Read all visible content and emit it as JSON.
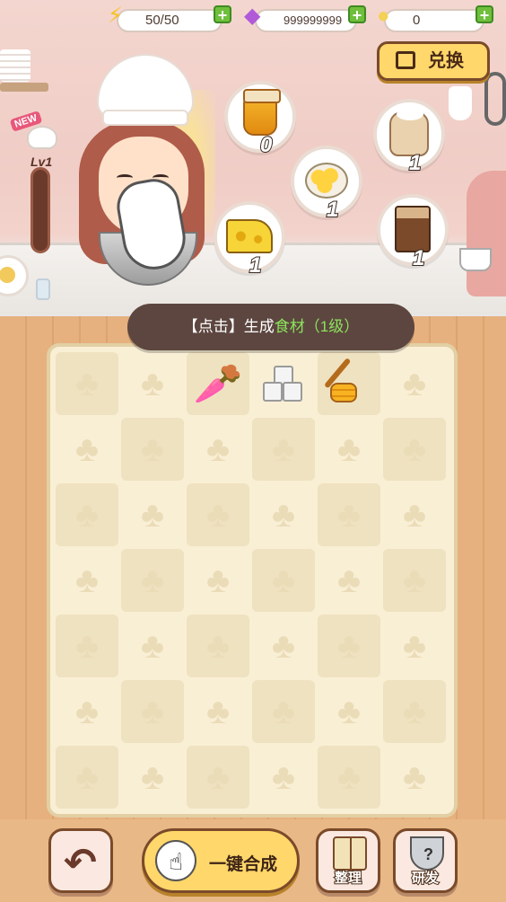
{
  "top_bar": {
    "energy": {
      "value": "50/50",
      "icon": "lightning-icon"
    },
    "gems": {
      "value": "999999999",
      "icon": "gem-icon"
    },
    "bulbs": {
      "value": "0",
      "icon": "lightbulb-icon"
    },
    "exchange_label": "兑换"
  },
  "level": {
    "badge_new": "NEW",
    "label": "Lv1"
  },
  "ingredients": [
    {
      "name": "honey",
      "count": "0",
      "icon": "honey-jar-icon"
    },
    {
      "name": "flour",
      "count": "1",
      "icon": "flour-sack-icon"
    },
    {
      "name": "corn",
      "count": "1",
      "icon": "corn-bowl-icon"
    },
    {
      "name": "cheese",
      "count": "1",
      "icon": "cheese-icon"
    },
    {
      "name": "coffee",
      "count": "1",
      "icon": "coffee-bag-icon"
    }
  ],
  "hint": {
    "prefix": "【点击】生成",
    "highlight": "食材（1级）"
  },
  "board": {
    "rows": 7,
    "cols": 6,
    "items": [
      {
        "row": 0,
        "col": 2,
        "item": "beet-icon"
      },
      {
        "row": 0,
        "col": 3,
        "item": "sugar-cubes-icon"
      },
      {
        "row": 0,
        "col": 4,
        "item": "honey-dipper-icon"
      }
    ]
  },
  "bottom_bar": {
    "back_icon": "back-arrow-icon",
    "merge_all_label": "一键合成",
    "sort_label": "整理",
    "research_label": "研发"
  }
}
